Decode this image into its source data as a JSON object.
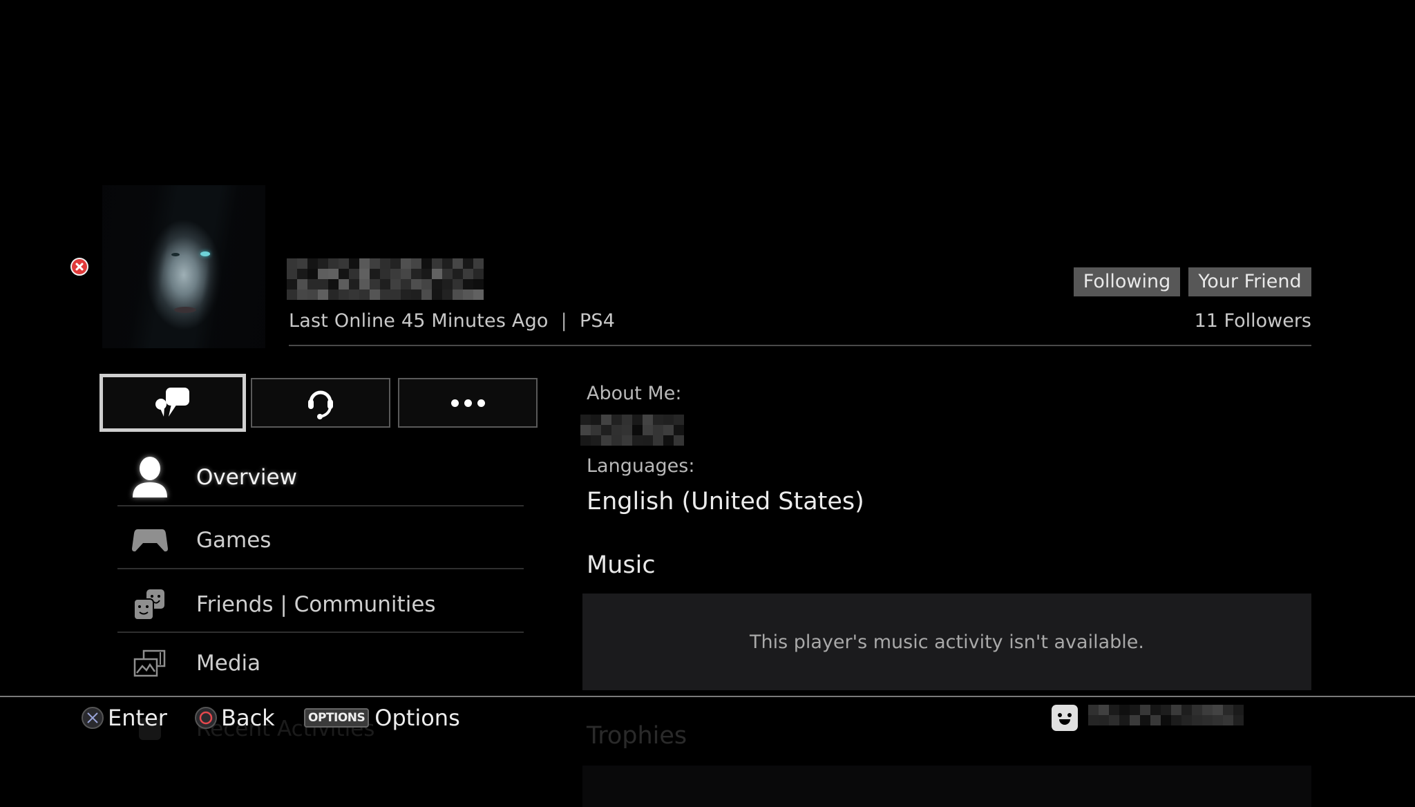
{
  "profile": {
    "online_id": "[pixelated]",
    "last_online": "Last Online 45 Minutes Ago",
    "separator": "|",
    "platform": "PS4",
    "tags": [
      "Following",
      "Your Friend"
    ],
    "followers": "11 Followers",
    "avatar_description": "dark-haired woman portrait"
  },
  "icons": {
    "error": "error-x-icon",
    "message": "speech-bubbles-icon",
    "party": "headset-icon",
    "more": "ellipsis-icon"
  },
  "actions": [
    {
      "name": "send-message",
      "icon": "speech-bubbles-icon",
      "selected": true
    },
    {
      "name": "start-party",
      "icon": "headset-icon",
      "selected": false
    },
    {
      "name": "more-options",
      "icon": "ellipsis-icon",
      "selected": false
    }
  ],
  "nav": {
    "items": [
      {
        "label": "Overview",
        "icon": "person-icon",
        "active": true
      },
      {
        "label": "Games",
        "icon": "gamepad-icon",
        "active": false
      },
      {
        "label": "Friends | Communities",
        "icon": "friends-icon",
        "active": false
      },
      {
        "label": "Media",
        "icon": "media-icon",
        "active": false
      },
      {
        "label": "Recent Activities",
        "icon": "activity-icon",
        "active": false
      }
    ]
  },
  "overview": {
    "about_label": "About Me:",
    "about_value": "[pixelated]",
    "languages_label": "Languages:",
    "languages_value": "English (United States)",
    "music_title": "Music",
    "music_message": "This player's music activity isn't available.",
    "trophies_title": "Trophies"
  },
  "footer": {
    "enter": "Enter",
    "back": "Back",
    "options_glyph": "OPTIONS",
    "options": "Options",
    "signed_in_user": "[pixelated]"
  },
  "colors": {
    "background": "#000000",
    "tag_bg": "#575757",
    "music_box_bg": "#1b1b1d",
    "error_red": "#e03a3a",
    "circle_button_red": "#e5484d",
    "cross_button_blue": "#9aa4d8"
  }
}
